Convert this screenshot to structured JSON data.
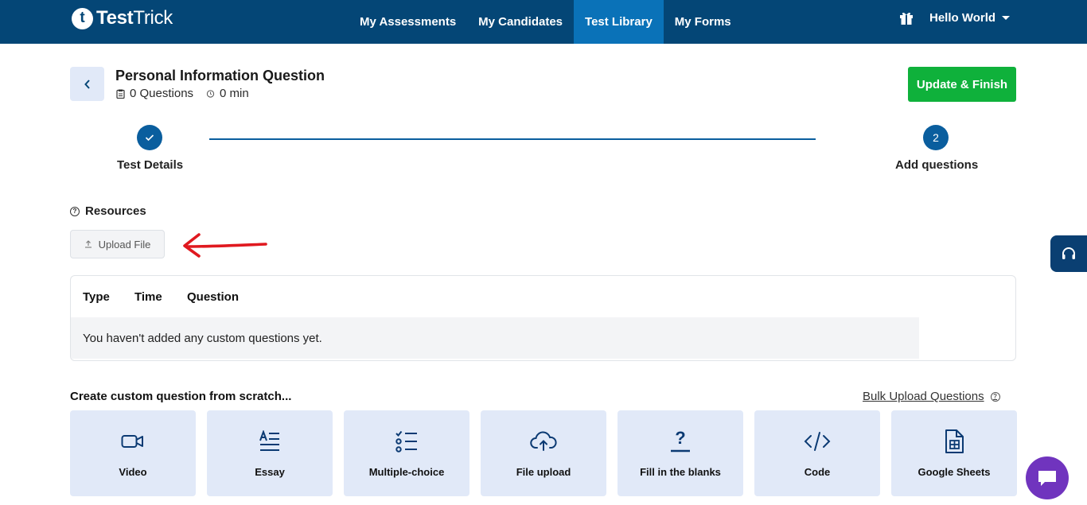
{
  "app": {
    "logo_letter": "t",
    "logo_bold": "Test",
    "logo_light": "Trick"
  },
  "nav": {
    "links": [
      "My Assessments",
      "My Candidates",
      "Test Library",
      "My Forms"
    ],
    "active": "Test Library",
    "user": "Hello World"
  },
  "header": {
    "back_label": "<",
    "title": "Personal Information Question",
    "questions": "0 Questions",
    "duration": "0 min",
    "update_button": "Update & Finish"
  },
  "stepper": {
    "steps": [
      {
        "label": "Test Details",
        "state": "done"
      },
      {
        "label": "Add questions",
        "number": "2",
        "state": "current"
      }
    ]
  },
  "resources": {
    "label": "Resources",
    "upload_button": "Upload File"
  },
  "table": {
    "columns": [
      "Type",
      "Time",
      "Question"
    ],
    "empty_message": "You haven't added any custom questions yet."
  },
  "create": {
    "title": "Create custom question from scratch...",
    "bulk_link": "Bulk Upload Questions",
    "types": [
      {
        "label": "Video",
        "icon": "video-icon"
      },
      {
        "label": "Essay",
        "icon": "essay-icon"
      },
      {
        "label": "Multiple-choice",
        "icon": "list-check-icon"
      },
      {
        "label": "File upload",
        "icon": "cloud-upload-icon"
      },
      {
        "label": "Fill in the blanks",
        "icon": "question-blank-icon"
      },
      {
        "label": "Code",
        "icon": "code-icon"
      },
      {
        "label": "Google Sheets",
        "icon": "sheet-icon"
      }
    ]
  },
  "colors": {
    "navbar": "#044676",
    "nav_active": "#0a72b8",
    "primary_button": "#0fb13b",
    "card_bg": "#e1e9f8",
    "chat_bubble": "#7034be",
    "annotation_arrow": "#e0191f"
  }
}
